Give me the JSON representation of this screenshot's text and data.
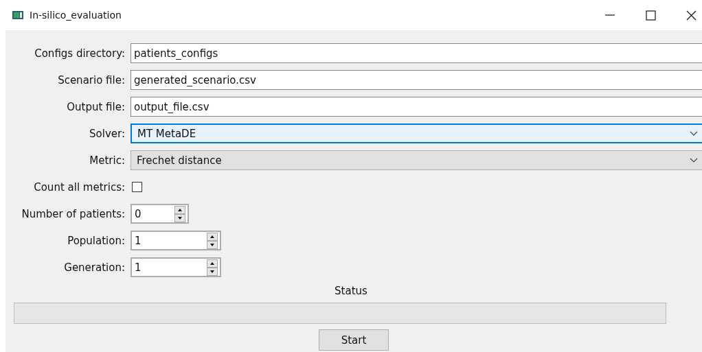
{
  "window": {
    "title": "In-silico_evaluation"
  },
  "form": [
    {
      "kind": "text",
      "label": "Configs directory:",
      "value": "patients_configs"
    },
    {
      "kind": "text",
      "label": "Scenario file:",
      "value": "generated_scenario.csv"
    },
    {
      "kind": "text",
      "label": "Output file:",
      "value": "output_file.csv"
    },
    {
      "kind": "dropdown",
      "label": "Solver:",
      "value": "MT MetaDE",
      "focused": true
    },
    {
      "kind": "dropdown",
      "label": "Metric:",
      "value": "Frechet distance",
      "focused": false
    },
    {
      "kind": "checkbox",
      "label": "Count all metrics:",
      "checked": false
    },
    {
      "kind": "spin",
      "label": "Number of patients:",
      "value": "0"
    },
    {
      "kind": "spin",
      "label": "Population:",
      "value": "1"
    },
    {
      "kind": "spin",
      "label": "Generation:",
      "value": "1"
    }
  ],
  "status": {
    "label": "Status",
    "level": 0
  },
  "buttons": [
    "Start"
  ]
}
